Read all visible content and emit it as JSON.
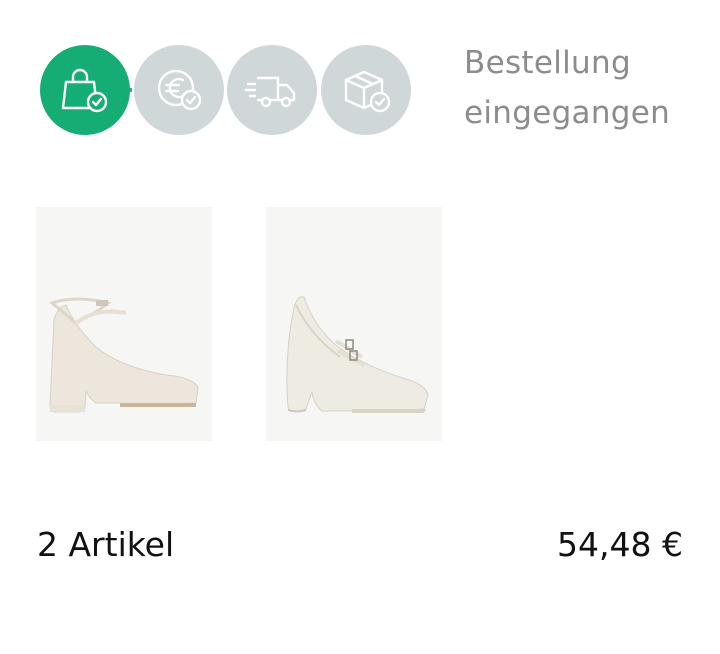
{
  "order_status": {
    "steps": [
      {
        "icon": "shopping-bag-check-icon",
        "state": "done",
        "color": "#16ad74"
      },
      {
        "icon": "euro-check-icon",
        "state": "pending",
        "color": "#cfd7d9"
      },
      {
        "icon": "delivery-truck-icon",
        "state": "pending",
        "color": "#cfd7d9"
      },
      {
        "icon": "box-check-icon",
        "state": "pending",
        "color": "#cfd7d9"
      }
    ],
    "status_label": "Bestellung eingegangen"
  },
  "products": [
    {
      "image": "cream-platform-pump-ankle-strap"
    },
    {
      "image": "cream-platform-mary-jane-pump"
    }
  ],
  "summary": {
    "item_count": "2 Artikel",
    "total": "54,48 €"
  }
}
